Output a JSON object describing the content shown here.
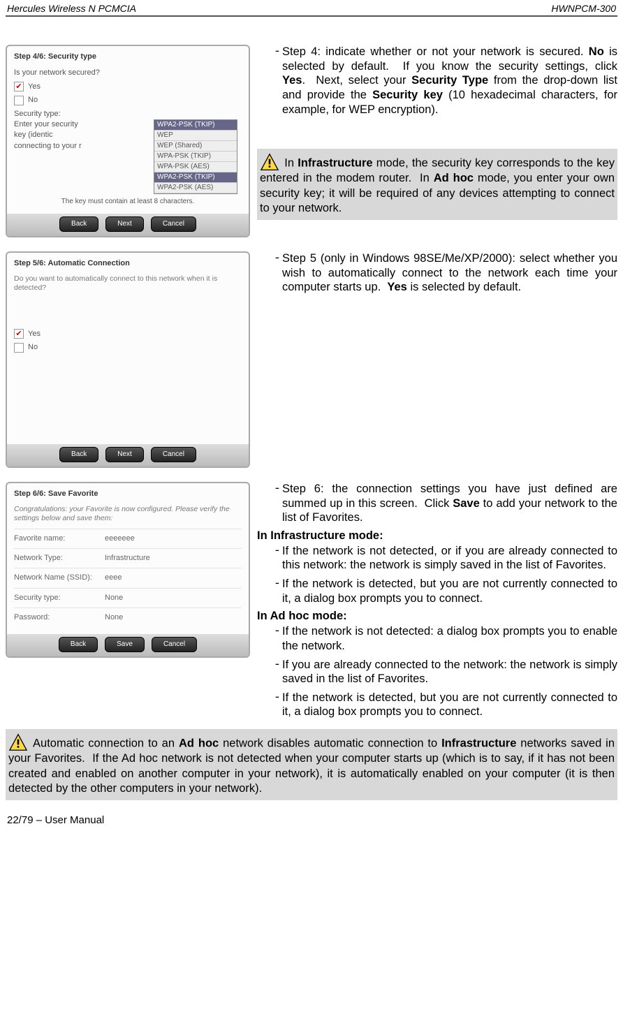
{
  "header": {
    "left": "Hercules Wireless N PCMCIA",
    "right": "HWNPCM-300"
  },
  "step4": {
    "title": "Step 4/6: Security type",
    "q": "Is your network secured?",
    "yes": "Yes",
    "no": "No",
    "sectype": "Security type:",
    "enterkey": "Enter your security key (identic connecting to your r",
    "dropopts": [
      "WPA2-PSK (TKIP)",
      "WEP",
      "WEP (Shared)",
      "WPA-PSK (TKIP)",
      "WPA-PSK (AES)",
      "WPA2-PSK (TKIP)",
      "WPA2-PSK (AES)"
    ],
    "hint": "The key must contain at least 8 characters.",
    "btns": {
      "back": "Back",
      "next": "Next",
      "cancel": "Cancel"
    },
    "body": "Step 4: indicate whether or not your network is secured. <b>No</b> is selected by default.&nbsp;&nbsp;If you know the security settings, click <b>Yes</b>.&nbsp;&nbsp;Next, select your <b>Security Type</b> from the drop-down list and provide the <b>Security key</b> (10 hexadecimal characters, for example, for WEP encryption)."
  },
  "notice1": "In <b>Infrastructure</b> mode, the security key corresponds to the key entered in the modem router.&nbsp;&nbsp;In <b>Ad hoc</b> mode, you enter your own security key; it will be required of any devices attempting to connect to your network.",
  "step5": {
    "title": "Step 5/6: Automatic Connection",
    "q": "Do you want to automatically connect to this network when it is detected?",
    "yes": "Yes",
    "no": "No",
    "btns": {
      "back": "Back",
      "next": "Next",
      "cancel": "Cancel"
    },
    "body": "Step 5 (only in Windows 98SE/Me/XP/2000): select whether you wish to automatically connect to the network each time your computer starts up.&nbsp;&nbsp;<b>Yes</b> is selected by default."
  },
  "step6": {
    "title": "Step 6/6: Save Favorite",
    "note": "Congratulations: your Favorite is now configured. Please verify the settings below and save them:",
    "rows": [
      [
        "Favorite name:",
        "eeeeeee"
      ],
      [
        "Network Type:",
        "Infrastructure"
      ],
      [
        "Network Name (SSID):",
        "eeee"
      ],
      [
        "Security type:",
        "None"
      ],
      [
        "Password:",
        "None"
      ]
    ],
    "btns": {
      "back": "Back",
      "save": "Save",
      "cancel": "Cancel"
    },
    "body": "Step 6: the connection settings you have just defined are summed up in this screen.&nbsp;&nbsp;Click <b>Save</b> to add your network to the list of Favorites.",
    "infra_head": "In Infrastructure mode:",
    "infra1": "If the network is not detected, or if you are already connected to this network: the network is simply saved in the list of Favorites.",
    "infra2": "If the network is detected, but you are not currently connected to it, a dialog box prompts you to connect.",
    "adhoc_head": "In Ad hoc mode:",
    "adhoc1": "If the network is not detected: a dialog box prompts you to enable the network.",
    "adhoc2": "If you are already connected to the network: the network is simply saved in the list of Favorites.",
    "adhoc3": "If the network is detected, but you are not currently connected to it, a dialog box prompts you to connect."
  },
  "notice2": "Automatic connection to an <b>Ad hoc</b> network disables automatic connection to <b>Infrastructure</b> networks saved in your Favorites.&nbsp;&nbsp;If the Ad hoc network is not detected when your computer starts up (which is to say, if it has not been created and enabled on another computer in your network), it is automatically enabled on your computer (it is then detected by the other computers in your network).",
  "footer": "22/79 – User Manual"
}
